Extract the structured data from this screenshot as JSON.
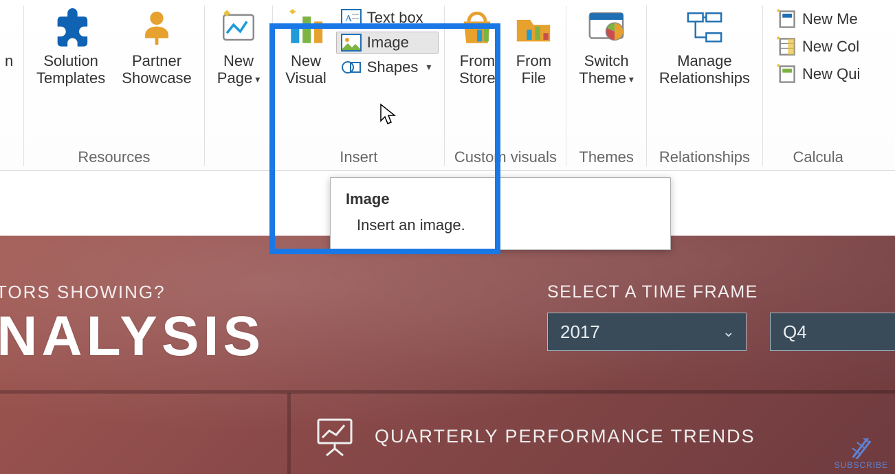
{
  "ribbon": {
    "groups": {
      "resources": {
        "label": "Resources",
        "solution_templates": "Solution\nTemplates",
        "partner_showcase": "Partner\nShowcase"
      },
      "pages": {
        "new_page": "New\nPage"
      },
      "insert": {
        "label": "Insert",
        "new_visual": "New\nVisual",
        "text_box": "Text box",
        "image": "Image",
        "shapes": "Shapes"
      },
      "custom_visuals": {
        "label": "Custom visuals",
        "from_store": "From\nStore",
        "from_file": "From\nFile"
      },
      "themes": {
        "label": "Themes",
        "switch_theme": "Switch\nTheme"
      },
      "relationships": {
        "label": "Relationships",
        "manage": "Manage\nRelationships"
      },
      "calculations": {
        "label": "Calcula",
        "new_me": "New Me",
        "new_col": "New Col",
        "new_qui": "New Qui"
      }
    }
  },
  "tooltip": {
    "title": "Image",
    "body": "Insert an image."
  },
  "canvas": {
    "pre_title": "TORS SHOWING?",
    "main_title": "ANALYSIS",
    "timeframe_label": "SELECT A TIME FRAME",
    "year": "2017",
    "quarter": "Q4",
    "widget_title": "QUARTERLY PERFORMANCE TRENDS"
  },
  "watermark": "SUBSCRIBE"
}
